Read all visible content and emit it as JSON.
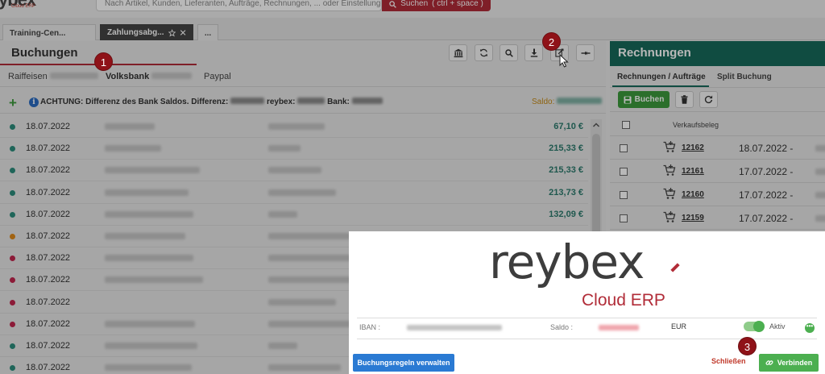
{
  "topbar": {
    "logo_text": "ybex",
    "logo_sub": "Cloud ERP",
    "search_placeholder": "Nach Artikel, Kunden, Lieferanten, Aufträge, Rechnungen, ... oder Einstellungen",
    "search_button": "Suchen",
    "search_shortcut": "( ctrl + space )"
  },
  "tabs": [
    {
      "label": "Training-Cen..."
    },
    {
      "label": "Zahlungsabg..."
    },
    {
      "label": "..."
    }
  ],
  "left": {
    "title": "Buchungen",
    "bank_tabs": [
      "Raiffeisen",
      "Volksbank",
      "Paypal"
    ],
    "warning": "ACHTUNG: Differenz des Bank Saldos. Differenz:",
    "warning_reybex": "reybex:",
    "warning_bank": "Bank:",
    "saldo_label": "Saldo:",
    "rows": [
      {
        "date": "18.07.2022",
        "amount": "67,10 €",
        "dot": "#2c8c7c"
      },
      {
        "date": "18.07.2022",
        "amount": "215,33 €",
        "dot": "#2c8c7c"
      },
      {
        "date": "18.07.2022",
        "amount": "215,33 €",
        "dot": "#2c8c7c"
      },
      {
        "date": "18.07.2022",
        "amount": "213,73 €",
        "dot": "#2c8c7c"
      },
      {
        "date": "18.07.2022",
        "amount": "132,09 €",
        "dot": "#2c8c7c"
      },
      {
        "date": "18.07.2022",
        "amount": "",
        "dot": "#e08a1a"
      },
      {
        "date": "18.07.2022",
        "amount": "",
        "dot": "#c2264e"
      },
      {
        "date": "18.07.2022",
        "amount": "",
        "dot": "#c2264e"
      },
      {
        "date": "18.07.2022",
        "amount": "",
        "dot": "#c2264e"
      },
      {
        "date": "18.07.2022",
        "amount": "",
        "dot": "#c2264e"
      },
      {
        "date": "18.07.2022",
        "amount": "",
        "dot": "#2c8c7c"
      },
      {
        "date": "18.07.2022",
        "amount": "",
        "dot": "#2c8c7c"
      }
    ]
  },
  "right": {
    "title": "Rechnungen",
    "tabs": [
      "Rechnungen / Aufträge",
      "Split Buchung"
    ],
    "buchen_label": "Buchen",
    "column_label": "Verkaufsbeleg",
    "rows": [
      {
        "number": "12162",
        "date": "18.07.2022 -"
      },
      {
        "number": "12161",
        "date": "17.07.2022 -"
      },
      {
        "number": "12160",
        "date": "17.07.2022 -"
      },
      {
        "number": "12159",
        "date": "17.07.2022 -"
      }
    ]
  },
  "modal": {
    "brand_name": "reybex",
    "brand_sub": "Cloud ERP",
    "iban_label": "IBAN :",
    "saldo_label": "Saldo :",
    "currency": "EUR",
    "active_label": "Aktiv",
    "more_label": "•••",
    "rules_button": "Buchungsregeln verwalten",
    "close_button": "Schließen",
    "connect_button": "Verbinden"
  },
  "steps": [
    "1",
    "2",
    "3"
  ],
  "colors": {
    "accent_red": "#b12c38",
    "teal": "#176a5a",
    "green": "#3c9a3c",
    "blue": "#2a7ad3",
    "marker": "#8f1218"
  }
}
